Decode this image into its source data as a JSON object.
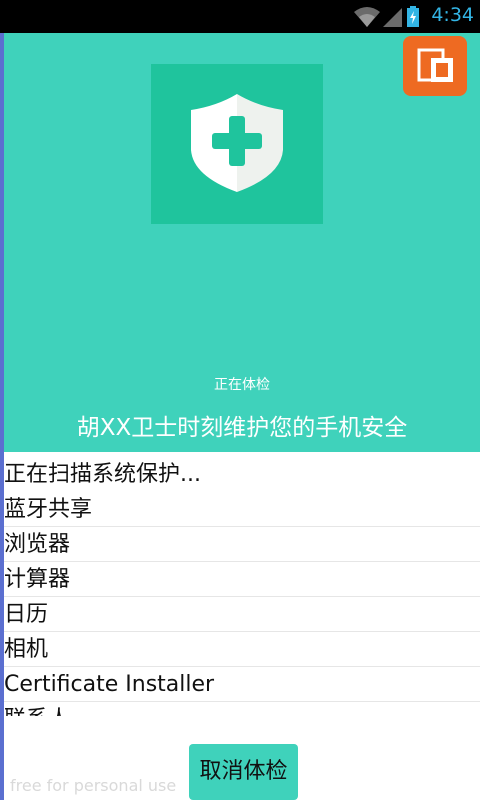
{
  "status_bar": {
    "time": "4:34"
  },
  "hero": {
    "scanning_label": "正在体检",
    "slogan": "胡XX卫士时刻维护您的手机安全"
  },
  "scan": {
    "status": "正在扫描系统保护...",
    "items": [
      "蓝牙共享",
      "浏览器",
      "计算器",
      "日历",
      "相机",
      "Certificate Installer",
      "联系人"
    ]
  },
  "footer": {
    "watermark": "free for personal use",
    "cancel_label": "取消体检"
  },
  "colors": {
    "accent": "#3fd2bb",
    "shield_bg": "#1fc49d",
    "corner_button": "#ee6a22",
    "status_text": "#33b5e5"
  },
  "icons": {
    "hero": "shield-plus-icon",
    "corner": "copy-icon",
    "wifi": "wifi-icon",
    "signal": "signal-icon",
    "battery": "battery-icon"
  }
}
